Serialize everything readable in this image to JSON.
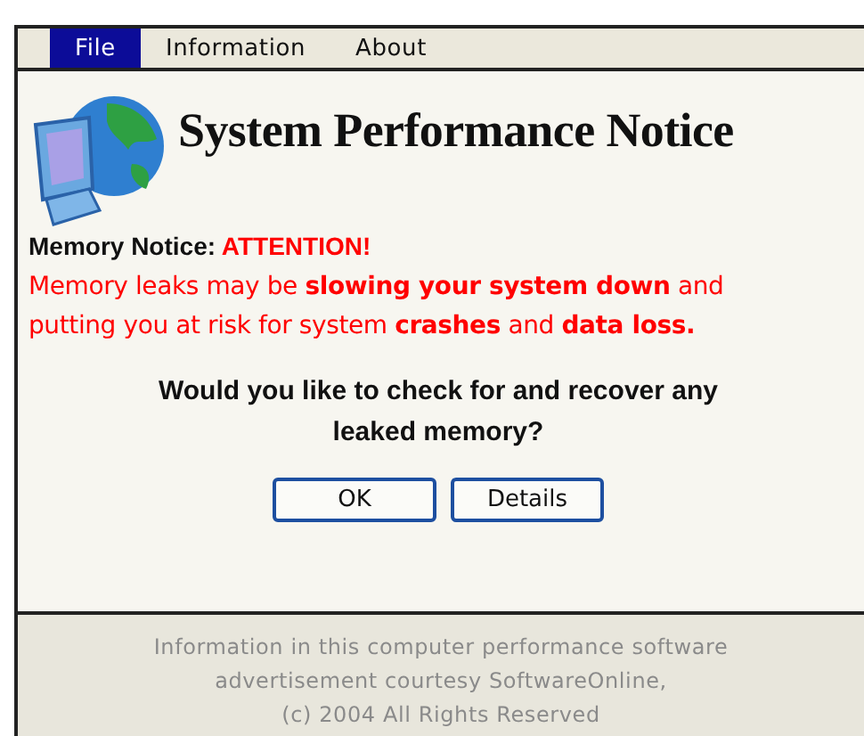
{
  "menu": [
    {
      "label": "File",
      "selected": true
    },
    {
      "label": "Information",
      "selected": false
    },
    {
      "label": "About",
      "selected": false
    }
  ],
  "title": "System Performance Notice",
  "notice_label": "Memory Notice:",
  "notice_alert": "ATTENTION!",
  "message": "Memory leaks may be **slowing your system down** and putting you at risk for system **crashes** and **data loss.**",
  "question": "Would you like to check for and recover any leaked memory?",
  "buttons": [
    "OK",
    "Details"
  ],
  "footer": [
    "Information in this computer performance software",
    "advertisement courtesy SoftwareOnline,",
    "(c) 2004 All Rights Reserved"
  ]
}
